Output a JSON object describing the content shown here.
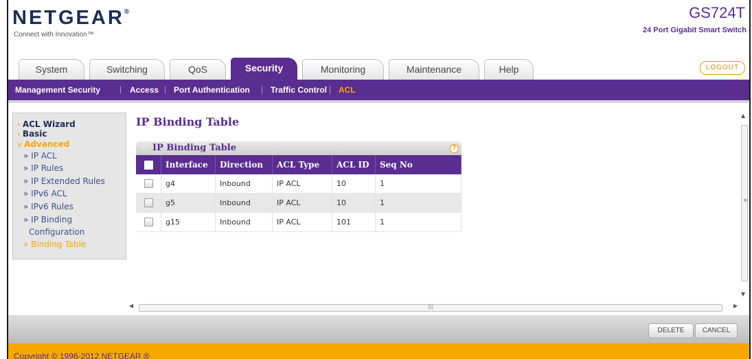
{
  "brand": {
    "logo_text": "NETGEAR",
    "tagline": "Connect with Innovation™"
  },
  "device": {
    "model": "GS724T",
    "subtitle": "24 Port Gigabit Smart Switch"
  },
  "tabs": [
    {
      "label": "System"
    },
    {
      "label": "Switching"
    },
    {
      "label": "QoS"
    },
    {
      "label": "Security"
    },
    {
      "label": "Monitoring"
    },
    {
      "label": "Maintenance"
    },
    {
      "label": "Help"
    }
  ],
  "active_tab": "Security",
  "logout_label": "LOGOUT",
  "subnav": [
    {
      "label": "Management Security"
    },
    {
      "label": "Access"
    },
    {
      "label": "Port Authentication"
    },
    {
      "label": "Traffic Control"
    },
    {
      "label": "ACL"
    }
  ],
  "sidebar": {
    "items": [
      {
        "label": "ACL Wizard"
      },
      {
        "label": "Basic"
      },
      {
        "label": "Advanced"
      }
    ],
    "subitems": [
      {
        "label": "» IP ACL"
      },
      {
        "label": "» IP Rules"
      },
      {
        "label": "» IP Extended Rules"
      },
      {
        "label": "» IPv6 ACL"
      },
      {
        "label": "» IPv6 Rules"
      },
      {
        "label": "» IP Binding"
      },
      {
        "label": "Configuration"
      },
      {
        "label": "» Binding Table"
      }
    ]
  },
  "page_title": "IP Binding Table",
  "panel": {
    "title": "IP Binding Table",
    "columns": [
      "Interface",
      "Direction",
      "ACL Type",
      "ACL ID",
      "Seq No"
    ],
    "rows": [
      {
        "interface": "g4",
        "direction": "Inbound",
        "acl_type": "IP ACL",
        "acl_id": "10",
        "seq_no": "1"
      },
      {
        "interface": "g5",
        "direction": "Inbound",
        "acl_type": "IP ACL",
        "acl_id": "10",
        "seq_no": "1"
      },
      {
        "interface": "g15",
        "direction": "Inbound",
        "acl_type": "IP ACL",
        "acl_id": "101",
        "seq_no": "1"
      }
    ]
  },
  "buttons": {
    "delete": "DELETE",
    "cancel": "CANCEL"
  },
  "copyright": "Copyright © 1996-2012 NETGEAR ®",
  "colors": {
    "brand_purple": "#5a2d91",
    "accent_orange": "#f7a800",
    "navy": "#1c2d55"
  }
}
